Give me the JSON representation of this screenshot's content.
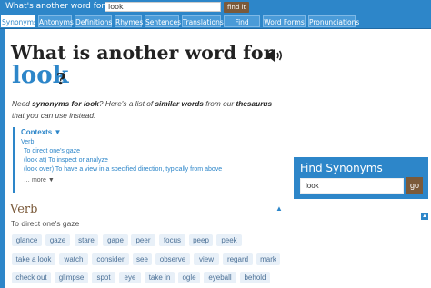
{
  "topbar": {
    "question": "What's another word for",
    "search_value": "look",
    "find_label": "find it"
  },
  "tabs": [
    {
      "label": "Synonyms",
      "active": true
    },
    {
      "label": "Antonyms",
      "active": false
    },
    {
      "label": "Definitions",
      "active": false
    },
    {
      "label": "Rhymes",
      "active": false
    },
    {
      "label": "Sentences",
      "active": false
    },
    {
      "label": "Translations",
      "active": false
    },
    {
      "label": "Find Words",
      "active": false
    },
    {
      "label": "Word Forms",
      "active": false
    },
    {
      "label": "Pronunciations",
      "active": false
    }
  ],
  "heading": {
    "line1": "What is another word for",
    "word": "look",
    "qmark": "?"
  },
  "speaker_icon": "speaker-icon",
  "intro": {
    "need": "Need ",
    "bold1": "synonyms for look",
    "mid": "? Here's a list of ",
    "bold2": "similar words",
    "mid2": " from our ",
    "bold3": "thesaurus",
    "end": " that you can use instead."
  },
  "contexts": {
    "title": "Contexts ▼",
    "pos": "Verb",
    "items": [
      "To direct one's gaze",
      "(look at) To inspect or analyze",
      "(look over) To have a view in a specified direction, typically from above"
    ],
    "more": "… more ▼"
  },
  "sidebar": {
    "title": "Find Synonyms",
    "input_value": "look",
    "go_label": "go"
  },
  "ad_badge": "▲",
  "section": {
    "pos": "Verb",
    "up_arrow": "▲",
    "sense": "To direct one's gaze"
  },
  "synonyms": [
    "glance",
    "gaze",
    "stare",
    "gape",
    "peer",
    "focus",
    "peep",
    "peek",
    "take a look",
    "watch",
    "consider",
    "see",
    "observe",
    "view",
    "regard",
    "mark",
    "check out",
    "glimpse",
    "spot",
    "eye",
    "take in",
    "ogle",
    "eyeball",
    "behold"
  ],
  "colors": {
    "brand_blue": "#2d86c9",
    "brown": "#7b5a3a",
    "chip_bg": "#e8f0f8"
  }
}
